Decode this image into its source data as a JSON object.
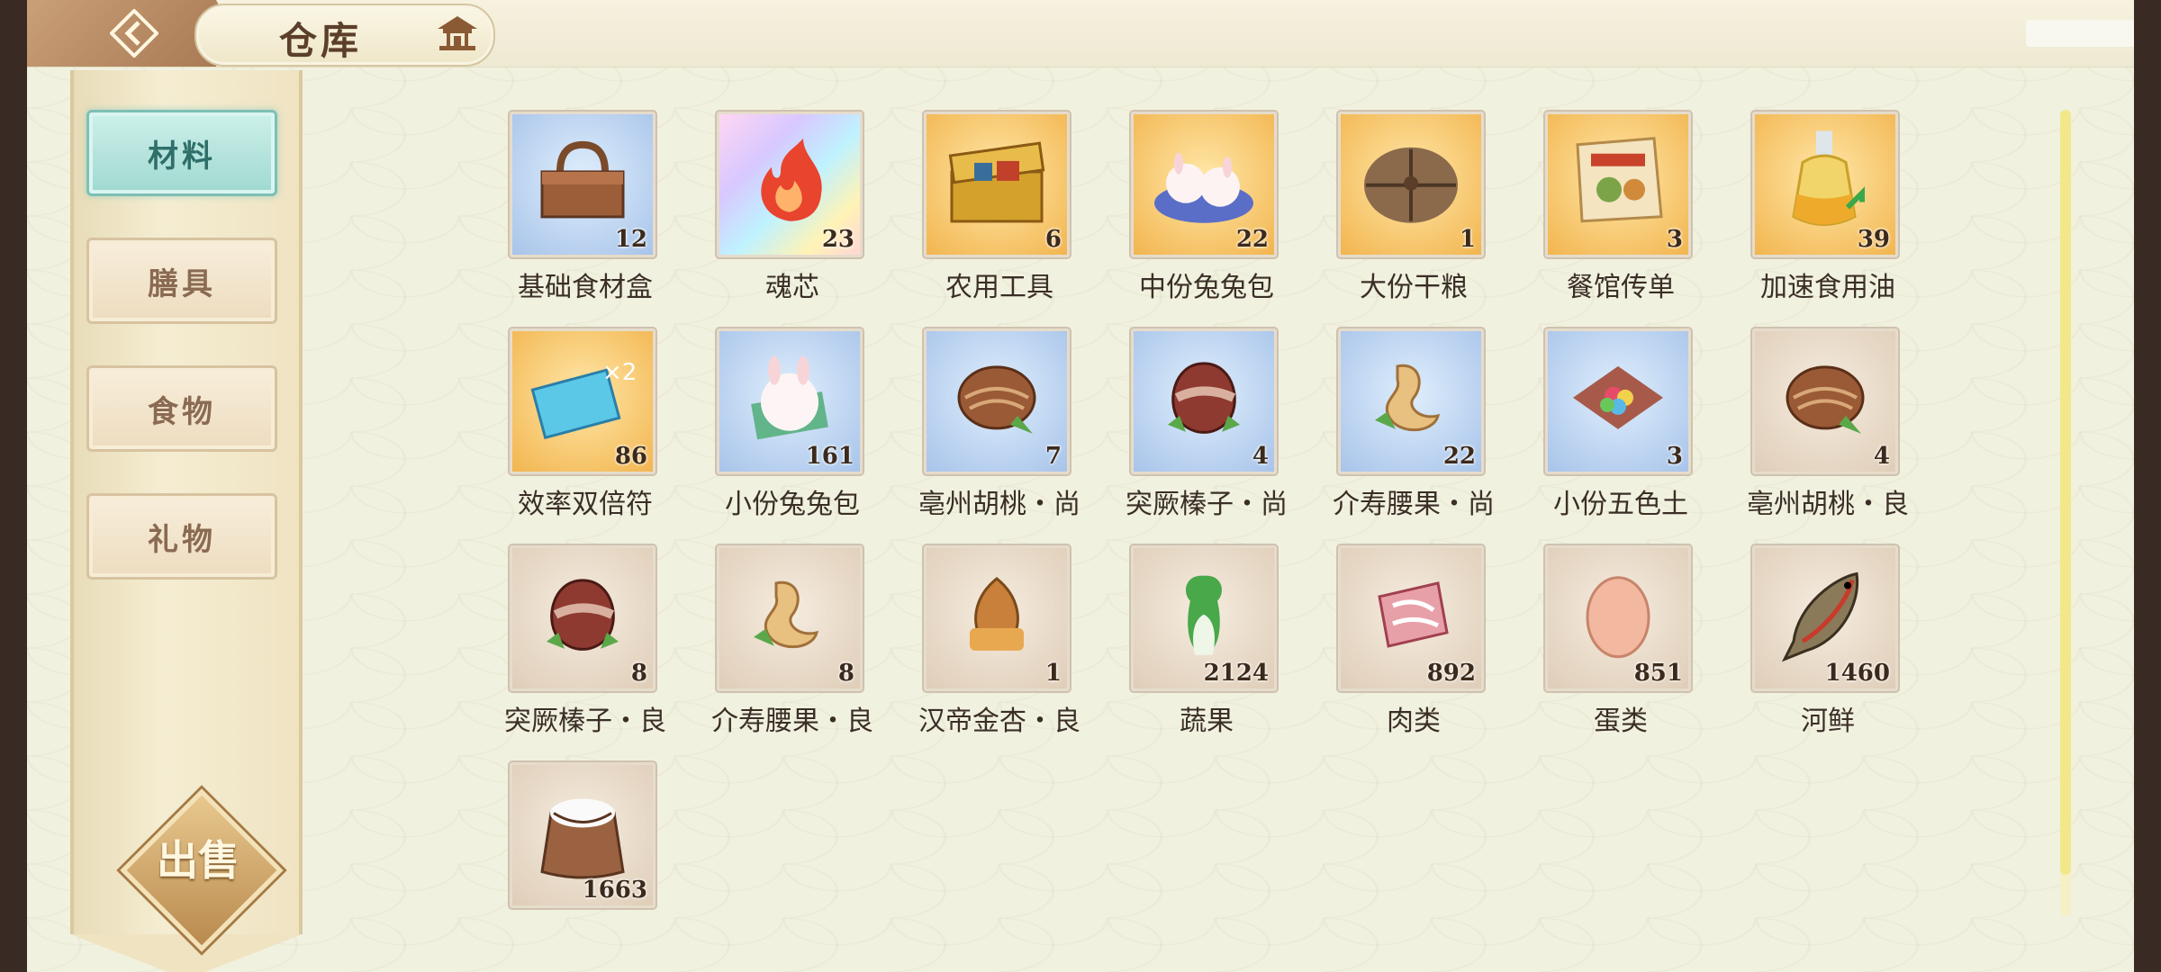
{
  "header": {
    "title": "仓库"
  },
  "sidebar": {
    "tabs": [
      {
        "label": "材料",
        "active": true
      },
      {
        "label": "膳具",
        "active": false
      },
      {
        "label": "食物",
        "active": false
      },
      {
        "label": "礼物",
        "active": false
      }
    ],
    "sell_label": "出售"
  },
  "items": [
    {
      "name": "基础食材盒",
      "count": "12",
      "bg": "blue",
      "icon": "basket-icon"
    },
    {
      "name": "魂芯",
      "count": "23",
      "bg": "rainbow",
      "icon": "flame-spirit-icon"
    },
    {
      "name": "农用工具",
      "count": "6",
      "bg": "gold",
      "icon": "toolbox-icon"
    },
    {
      "name": "中份兔兔包",
      "count": "22",
      "bg": "gold",
      "icon": "bunny-buns-icon"
    },
    {
      "name": "大份干粮",
      "count": "1",
      "bg": "gold",
      "icon": "sack-bundle-icon"
    },
    {
      "name": "餐馆传单",
      "count": "3",
      "bg": "gold",
      "icon": "flyer-icon"
    },
    {
      "name": "加速食用油",
      "count": "39",
      "bg": "gold",
      "icon": "oil-bottle-icon"
    },
    {
      "name": "效率双倍符",
      "count": "86",
      "bg": "gold",
      "icon": "double-ticket-icon"
    },
    {
      "name": "小份兔兔包",
      "count": "161",
      "bg": "blue",
      "icon": "bunny-bun-icon"
    },
    {
      "name": "亳州胡桃・尚",
      "count": "7",
      "bg": "blue",
      "icon": "walnut-icon"
    },
    {
      "name": "突厥榛子・尚",
      "count": "4",
      "bg": "blue",
      "icon": "hazelnut-icon"
    },
    {
      "name": "介寿腰果・尚",
      "count": "22",
      "bg": "blue",
      "icon": "cashew-icon"
    },
    {
      "name": "小份五色土",
      "count": "3",
      "bg": "blue",
      "icon": "five-color-soil-icon"
    },
    {
      "name": "亳州胡桃・良",
      "count": "4",
      "bg": "tan",
      "icon": "walnut-icon"
    },
    {
      "name": "突厥榛子・良",
      "count": "8",
      "bg": "tan",
      "icon": "hazelnut-icon"
    },
    {
      "name": "介寿腰果・良",
      "count": "8",
      "bg": "tan",
      "icon": "cashew-icon"
    },
    {
      "name": "汉帝金杏・良",
      "count": "1",
      "bg": "tan",
      "icon": "apricot-kernel-icon"
    },
    {
      "name": "蔬果",
      "count": "2124",
      "bg": "tan",
      "icon": "bok-choy-icon"
    },
    {
      "name": "肉类",
      "count": "892",
      "bg": "tan",
      "icon": "meat-icon"
    },
    {
      "name": "蛋类",
      "count": "851",
      "bg": "tan",
      "icon": "egg-icon"
    },
    {
      "name": "河鲜",
      "count": "1460",
      "bg": "tan",
      "icon": "fish-icon"
    },
    {
      "name": "",
      "count": "1663",
      "bg": "tan",
      "icon": "rice-sack-icon"
    }
  ]
}
